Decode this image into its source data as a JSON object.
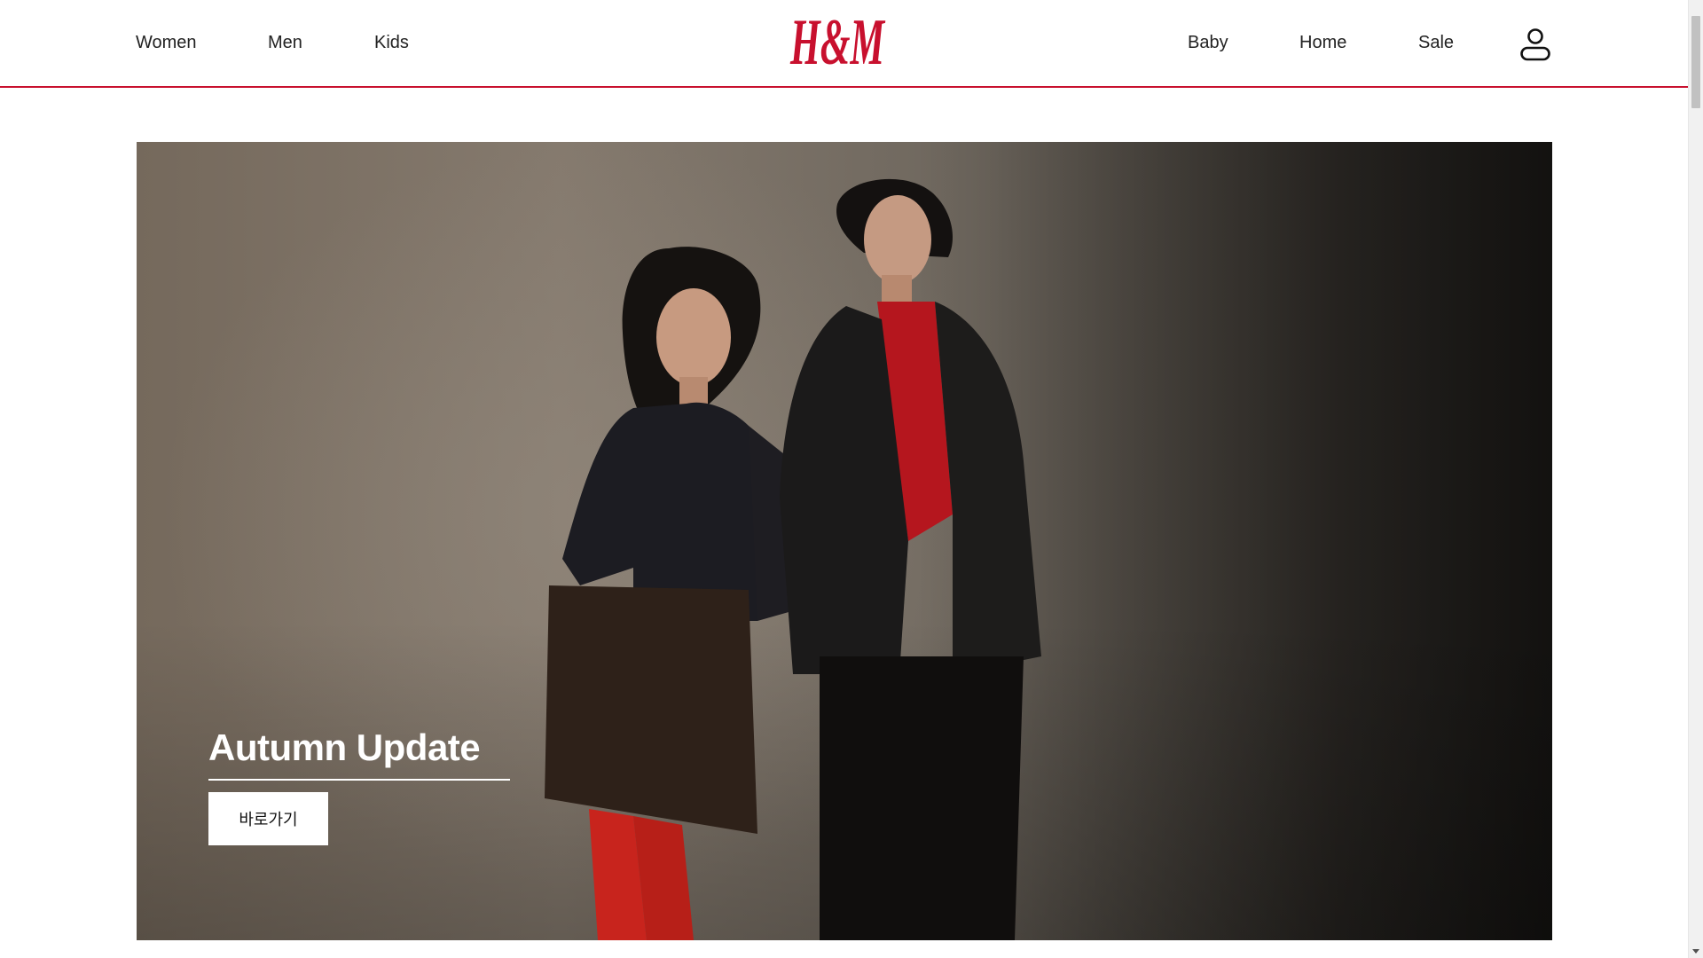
{
  "header": {
    "nav_left": [
      "Women",
      "Men",
      "Kids"
    ],
    "nav_right": [
      "Baby",
      "Home",
      "Sale"
    ],
    "logo_text": "H&M",
    "brand_color": "#c8102e",
    "account_icon": "user-icon"
  },
  "hero": {
    "title": "Autumn Update",
    "cta_label": "바로가기"
  },
  "colors": {
    "accent": "#c8102e",
    "text": "#222222",
    "background": "#ffffff"
  }
}
